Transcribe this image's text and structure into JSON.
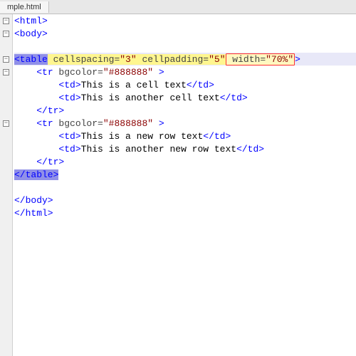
{
  "tab": {
    "filename": "mple.html"
  },
  "code": {
    "tags": {
      "html_open": "<html>",
      "html_close": "</html>",
      "body_open": "<body>",
      "body_close": "</body>",
      "table_open_tag": "<table",
      "table_close": "</table>",
      "tr_open_tag": "<tr",
      "tr_close": "</tr>",
      "td_open": "<td>",
      "td_close": "</td>",
      "gt": ">"
    },
    "attrs": {
      "cellspacing_name": " cellspacing",
      "cellspacing_val": "\"3\"",
      "cellpadding_name": " cellpadding",
      "cellpadding_val": "\"5\"",
      "width_name": " width",
      "width_val": "\"70%\"",
      "bgcolor_name": " bgcolor",
      "bgcolor_val": "\"#888888\"",
      "eq": "=",
      "sp": " "
    },
    "content": {
      "cell1": "This is a cell text",
      "cell2": "This is another cell text",
      "cell3": "This is a new row text",
      "cell4": "This is another new row text"
    }
  },
  "indent": {
    "i0": "",
    "i1": "    ",
    "i2": "        "
  }
}
